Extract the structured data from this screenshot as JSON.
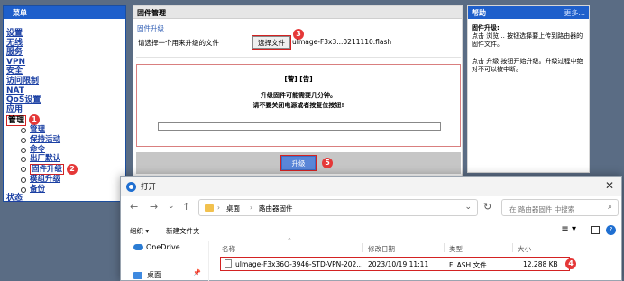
{
  "sidebar": {
    "header": "菜单",
    "items": [
      "设置",
      "无线",
      "服务",
      "VPN",
      "安全",
      "访问限制",
      "NAT",
      "QoS设置",
      "应用"
    ],
    "admin_label": "管理",
    "admin_badge": "1",
    "sub_items": [
      "管理",
      "保持活动",
      "命令",
      "出厂默认",
      "固件升级",
      "模组升级",
      "备份"
    ],
    "firmware_badge": "2",
    "status": "状态"
  },
  "main": {
    "title": "固件管理",
    "section": "固件升级",
    "select_label": "请选择一个用来升级的文件",
    "choose_button": "选择文件",
    "choose_badge": "3",
    "file_name": "uImage-F3x3...0211110.flash",
    "warning_title": "[警] [告]",
    "warning_line1": "升级固件可能需要几分钟。",
    "warning_line2": "请不要关闭电源或者按复位按钮!",
    "upgrade_button": "升级",
    "upgrade_badge": "5"
  },
  "help": {
    "title": "帮助",
    "more": "更多...",
    "heading": "固件升级:",
    "para1": "点击 浏览... 按钮选择要上传到路由器的固件文件。",
    "para2": "点击 升级 按钮开始升级。升级过程中绝对不可以被中断。"
  },
  "dialog": {
    "title": "打开",
    "close": "✕",
    "breadcrumb": [
      "桌面",
      "路由器固件"
    ],
    "search_placeholder": "在 路由器固件 中搜索",
    "organize": "组织 ▾",
    "new_folder": "新建文件夹",
    "nav_items": [
      "OneDrive",
      "桌面"
    ],
    "columns": [
      "名称",
      "修改日期",
      "类型",
      "大小"
    ],
    "file": {
      "name": "uImage-F3x36Q-3946-STD-VPN-202...",
      "date": "2023/10/19 11:11",
      "type": "FLASH 文件",
      "size": "12,288 KB"
    },
    "file_badge": "4"
  },
  "colors": {
    "menu_blue": "#1e5fcb",
    "highlight_red": "#d32222",
    "badge_red": "#e53838",
    "upgrade_button": "#5a86d8"
  },
  "icons": [
    "folder-icon",
    "file-icon",
    "onedrive-cloud-icon",
    "desktop-icon",
    "search-icon",
    "refresh-icon",
    "help-icon",
    "pin-icon"
  ]
}
